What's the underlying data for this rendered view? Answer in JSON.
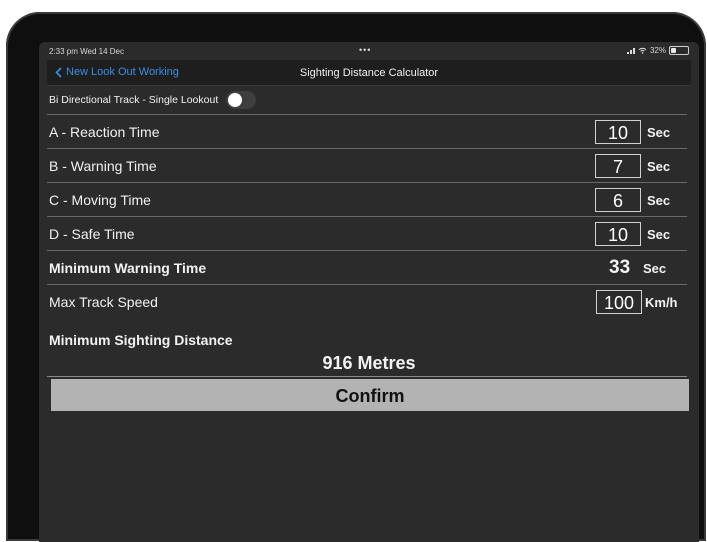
{
  "status": {
    "time": "2:33 pm  Wed 14 Dec",
    "dots": "•••",
    "battery": "32%",
    "battery_level": 0.32
  },
  "nav": {
    "back_label": "New Look Out Working",
    "title": "Sighting Distance Calculator"
  },
  "toggle": {
    "label": "Bi Directional Track - Single Lookout",
    "on": false
  },
  "rows": [
    {
      "label": "A - Reaction Time",
      "value": "10",
      "unit": "Sec"
    },
    {
      "label": "B - Warning Time",
      "value": "7",
      "unit": "Sec"
    },
    {
      "label": "C - Moving Time",
      "value": "6",
      "unit": "Sec"
    },
    {
      "label": "D - Safe Time",
      "value": "10",
      "unit": "Sec"
    }
  ],
  "minimum_warning": {
    "label": "Minimum Warning Time",
    "value": "33",
    "unit": "Sec"
  },
  "speed": {
    "label": "Max Track Speed",
    "value": "100",
    "unit": "Km/h"
  },
  "sighting": {
    "label": "Minimum Sighting Distance",
    "value": "916 Metres"
  },
  "confirm_label": "Confirm"
}
